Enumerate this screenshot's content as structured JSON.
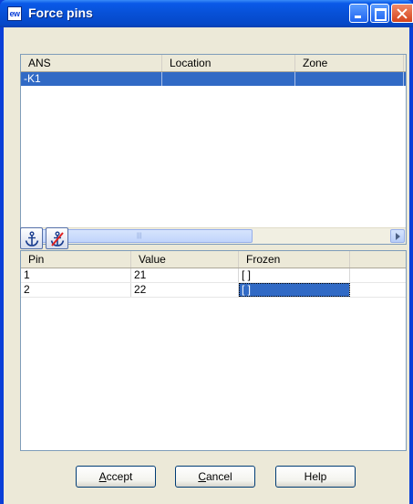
{
  "window": {
    "title": "Force pins",
    "icon_text": "ew",
    "controls": [
      "minimize-icon",
      "maximize-icon",
      "close-icon"
    ]
  },
  "components_list": {
    "columns": [
      "ANS",
      "Location",
      "Zone"
    ],
    "rows": [
      {
        "ans": "-K1",
        "location": "",
        "zone": "",
        "selected": true
      }
    ]
  },
  "toolbar": {
    "icons": [
      "anchor-icon",
      "unanchor-icon"
    ]
  },
  "pins_list": {
    "columns": [
      "Pin",
      "Value",
      "Frozen"
    ],
    "rows": [
      {
        "pin": "1",
        "value": "21",
        "frozen": "[ ]"
      },
      {
        "pin": "2",
        "value": "22",
        "frozen": "[ ]",
        "frozen_focused": true
      }
    ]
  },
  "buttons": {
    "accept": {
      "mnemonic": "A",
      "rest": "ccept"
    },
    "cancel": {
      "mnemonic": "C",
      "rest": "ancel"
    },
    "help": {
      "label": "Help"
    }
  },
  "colors": {
    "selection": "#316ac5",
    "titlebar": "#0750d6",
    "dialog_bg": "#ece9d8"
  }
}
